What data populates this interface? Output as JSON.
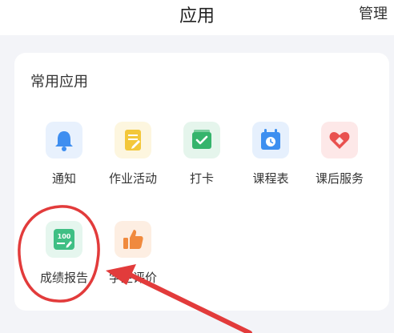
{
  "header": {
    "title": "应用",
    "manage_label": "管理"
  },
  "section": {
    "title": "常用应用"
  },
  "apps": [
    {
      "label": "通知",
      "icon": "bell-icon",
      "color": "#3e8ef0"
    },
    {
      "label": "作业活动",
      "icon": "document-edit-icon",
      "color": "#f3c73a"
    },
    {
      "label": "打卡",
      "icon": "checkmark-icon",
      "color": "#35b46c"
    },
    {
      "label": "课程表",
      "icon": "calendar-clock-icon",
      "color": "#3d8ff0"
    },
    {
      "label": "课后服务",
      "icon": "heart-hands-icon",
      "color": "#e9514f"
    },
    {
      "label": "成绩报告",
      "icon": "score-report-icon",
      "color": "#3fbf84"
    },
    {
      "label": "学生评价",
      "icon": "thumbs-up-icon",
      "color": "#f08a3e"
    }
  ],
  "annotation": {
    "color": "#e23b3b"
  }
}
